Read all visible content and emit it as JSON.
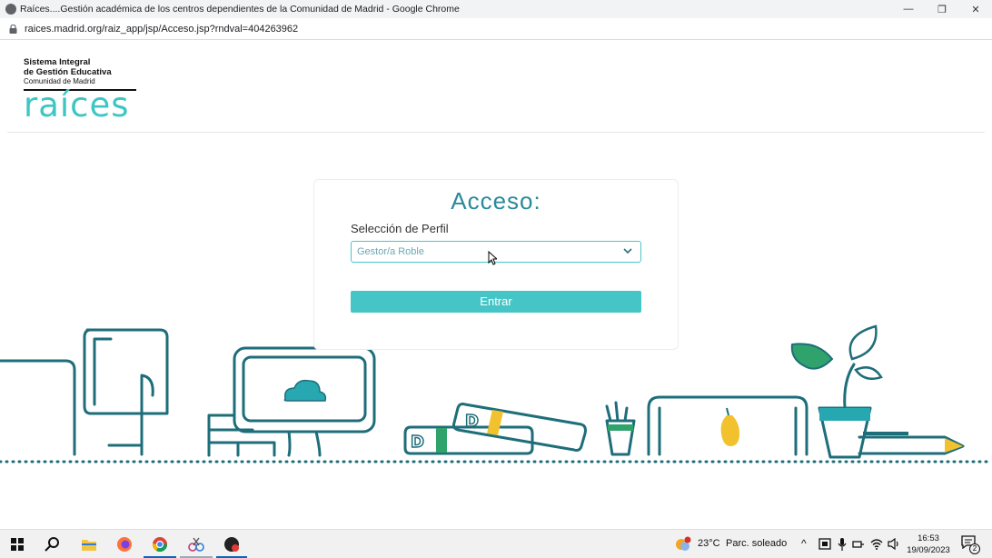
{
  "window": {
    "title": "Raíces....Gestión académica de los centros dependientes de la Comunidad de Madrid - Google Chrome",
    "controls": [
      "—",
      "❐",
      "✕"
    ]
  },
  "addressbar": {
    "url": "raices.madrid.org/raiz_app/jsp/Acceso.jsp?rndval=404263962"
  },
  "logo": {
    "line1": "Sistema Integral",
    "line2": "de Gestión Educativa",
    "line3": "Comunidad de Madrid",
    "wordmark": "raíces"
  },
  "login": {
    "heading": "Acceso:",
    "profile_label": "Selección de Perfil",
    "profile_value": "Gestor/a Roble",
    "submit_label": "Entrar"
  },
  "colors": {
    "accent": "#46c5c7",
    "heading": "#2a8a9a",
    "illustration_stroke": "#1e6e7a",
    "illustration_green": "#2fa36b",
    "illustration_yellow": "#f2c12e"
  },
  "taskbar": {
    "apps": [
      "windows-start",
      "search",
      "file-explorer",
      "firefox",
      "chrome",
      "snipping-tool",
      "other-app"
    ],
    "weather_temp": "23°C",
    "weather_desc": "Parc. soleado",
    "time": "16:53",
    "date": "19/09/2023",
    "notifications": "2"
  }
}
